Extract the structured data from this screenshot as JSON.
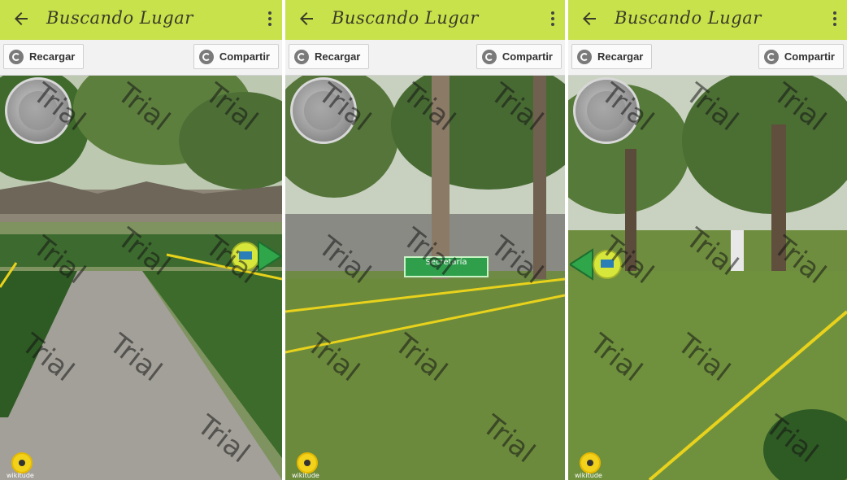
{
  "panels": [
    {
      "title": "Buscando Lugar",
      "buttons": {
        "reload": "Recargar",
        "share": "Compartir"
      },
      "logo_text": "wikitude",
      "watermarks": [
        "Trial",
        "Trial",
        "Trial",
        "Trial",
        "Trial",
        "Trial",
        "Trial",
        "Trial",
        "Trial"
      ]
    },
    {
      "title": "Buscando Lugar",
      "buttons": {
        "reload": "Recargar",
        "share": "Compartir"
      },
      "logo_text": "wikitude",
      "poi_label": "Secretaría",
      "watermarks": [
        "Trial",
        "Trial",
        "Trial",
        "Trial",
        "Trial",
        "Trial",
        "Trial",
        "Trial",
        "Trial"
      ]
    },
    {
      "title": "Buscando Lugar",
      "buttons": {
        "reload": "Recargar",
        "share": "Compartir"
      },
      "logo_text": "wikitude",
      "watermarks": [
        "Trial",
        "Trial",
        "Trial",
        "Trial",
        "Trial",
        "Trial",
        "Trial",
        "Trial",
        "Trial"
      ]
    }
  ],
  "colors": {
    "appbar": "#c7e24a",
    "toolbar": "#f2f2f2",
    "marker_green": "#2fa64a",
    "marker_yellow": "#d7e63a"
  },
  "icons": [
    "back-arrow-icon",
    "more-vert-icon",
    "reload-icon",
    "share-icon",
    "radar-icon",
    "wikitude-logo-icon",
    "direction-arrow-icon",
    "poi-marker-icon"
  ]
}
